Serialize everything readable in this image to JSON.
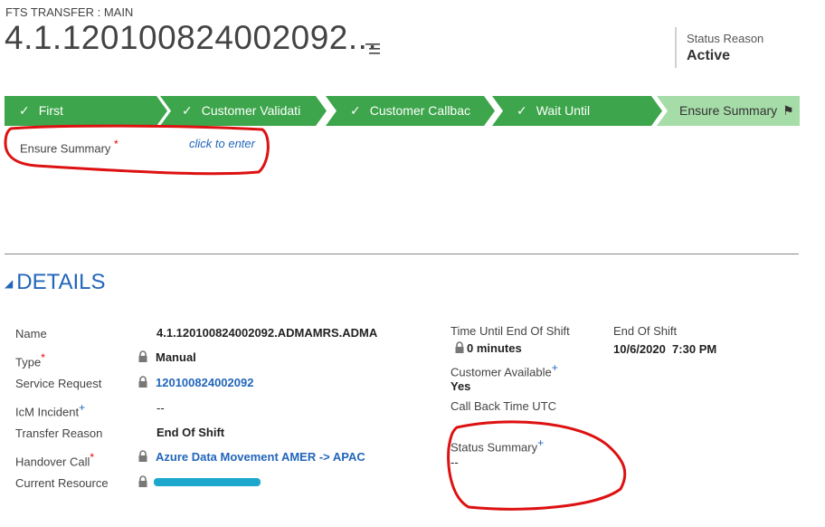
{
  "header": {
    "form_type": "FTS TRANSFER : MAIN",
    "title": "4.1.120100824002092...",
    "status_label": "Status Reason",
    "status_value": "Active"
  },
  "process": {
    "stages": [
      {
        "label": "First",
        "completed": true
      },
      {
        "label": "Customer Validati",
        "completed": true
      },
      {
        "label": "Customer Callbac",
        "completed": true
      },
      {
        "label": "Wait Until",
        "completed": true
      },
      {
        "label": "Ensure Summary",
        "completed": false,
        "active": true
      }
    ],
    "colors": {
      "completed": "#3da54b",
      "active": "#a6dca8"
    }
  },
  "ensure_summary": {
    "label": "Ensure Summary",
    "placeholder": "click to enter"
  },
  "details": {
    "header": "DETAILS",
    "left_fields": [
      {
        "label": "Name",
        "value": "4.1.120100824002092.ADMAMRS.ADMA"
      },
      {
        "label": "Type",
        "value": "Manual"
      },
      {
        "label": "Service Request",
        "value": "120100824002092"
      },
      {
        "label": "IcM Incident",
        "value": "--"
      },
      {
        "label": "Transfer Reason",
        "value": "End Of Shift"
      },
      {
        "label": "Handover Call",
        "value": "Azure Data Movement AMER -> APAC"
      },
      {
        "label": "Current Resource",
        "value": ""
      }
    ],
    "right_fields": {
      "time_until_label": "Time Until End Of Shift",
      "time_until_value": "0 minutes",
      "end_of_shift_label": "End Of Shift",
      "end_of_shift_value": "10/6/2020  7:30 PM",
      "customer_available_label": "Customer Available",
      "customer_available_value": "Yes",
      "call_back_label": "Call Back Time UTC",
      "status_summary_label": "Status Summary",
      "status_summary_value": "--"
    }
  },
  "icons": {
    "title_menu": "list-menu-icon",
    "lock": "lock-icon",
    "check": "check-icon",
    "flag": "flag-icon"
  },
  "colors": {
    "link": "#2266bb",
    "required": "#e00000",
    "annotation": "#dd1111",
    "redaction": "#1ea7cc"
  }
}
